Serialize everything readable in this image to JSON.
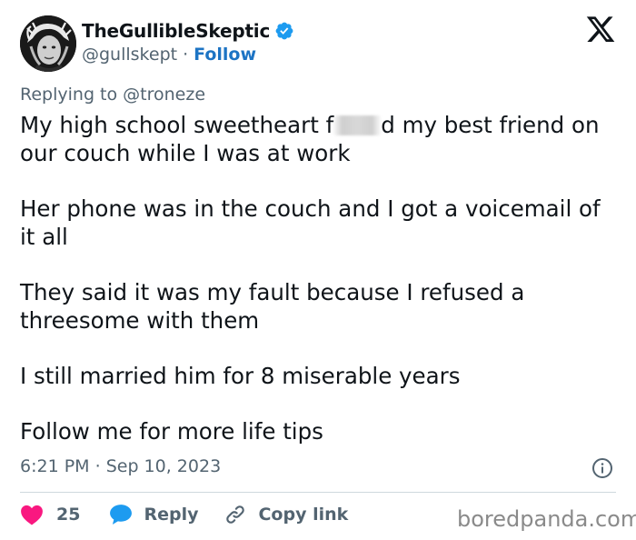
{
  "author": {
    "display_name": "TheGullibleSkeptic",
    "handle": "@gullskept",
    "separator": "·",
    "follow_label": "Follow"
  },
  "icons": {
    "avatar": "avatar-image",
    "verified": "verified-badge-icon",
    "platform": "x-logo-icon",
    "info": "info-icon",
    "like": "heart-icon",
    "reply": "reply-bubble-icon",
    "copy": "link-icon"
  },
  "colors": {
    "accent": "#1d9bf0",
    "heart": "#f91880",
    "secondary_text": "#536471"
  },
  "replying": {
    "prefix": "Replying to",
    "mention": "@troneze"
  },
  "tweet": {
    "line1_a": "My high school sweetheart f",
    "line1_b": "d my best friend on our couch while I was at work",
    "p2": "Her phone was in the couch and I got a voicemail of it all",
    "p3": "They said it was my fault because I refused a threesome with them",
    "p4": "I still married him for 8 miserable years",
    "p5": "Follow me for more life tips"
  },
  "timestamp": {
    "time": "6:21 PM",
    "separator": "·",
    "date": "Sep 10, 2023"
  },
  "actions": {
    "like_count": "25",
    "reply_label": "Reply",
    "copy_label": "Copy link"
  },
  "watermark": "boredpanda.com"
}
